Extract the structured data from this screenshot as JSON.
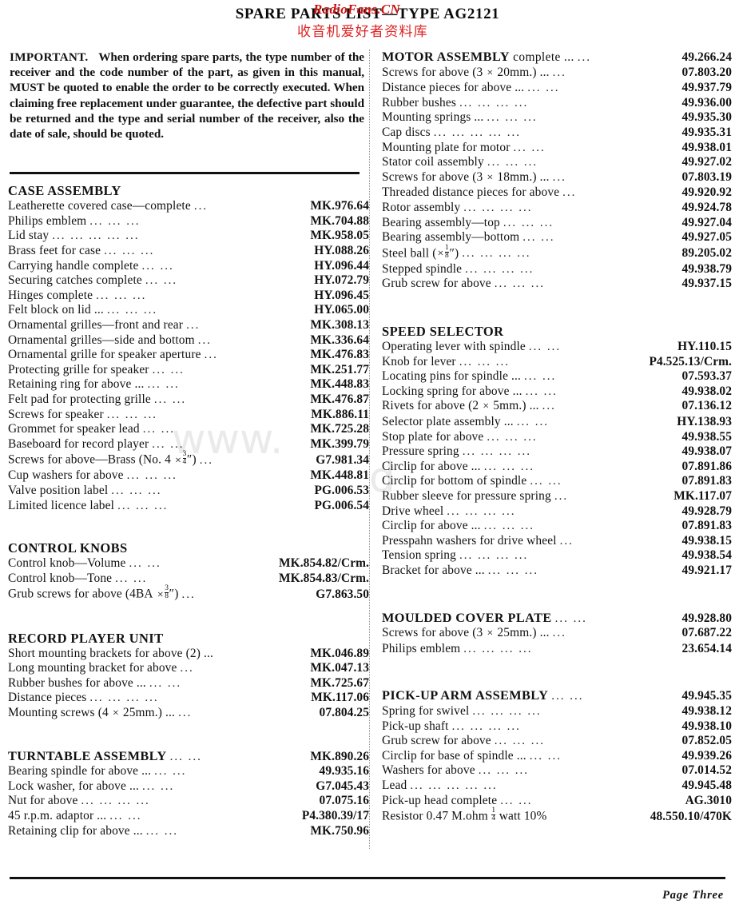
{
  "page": {
    "title": "SPARE PARTS LIST—TYPE AG2121",
    "footer": "Page Three",
    "watermark_latin": "RadioFans.CN",
    "watermark_cjk": "收音机爱好者资料库",
    "watermark_ghost_left": "www.",
    "watermark_ghost_right": "d",
    "accent_color": "#cc1111",
    "text_color": "#111111"
  },
  "intro": {
    "lead": "IMPORTANT.",
    "body": "When ordering spare parts, the type number of the receiver and the code number of the part, as given in this manual, MUST be quoted to enable the order to be correctly executed. When claiming free replacement under guarantee, the defective part should be returned and the type and serial number of the receiver, also the date of sale, should be quoted."
  },
  "left_column": {
    "sections": [
      {
        "heading": "CASE ASSEMBLY",
        "heading_style": "plain",
        "rows": [
          {
            "label": "Leatherette covered case—complete",
            "dots": "...",
            "code": "MK.976.64"
          },
          {
            "label": "Philips emblem",
            "dots": "...   ...   ...",
            "code": "MK.704.88"
          },
          {
            "label": "Lid stay",
            "dots": "...   ...   ...   ...   ...",
            "code": "MK.958.05"
          },
          {
            "label": "Brass feet for case",
            "dots": "...   ...   ...",
            "code": "HY.088.26"
          },
          {
            "label": "Carrying handle complete",
            "dots": "...   ...",
            "code": "HY.096.44"
          },
          {
            "label": "Securing catches complete",
            "dots": "...   ...",
            "code": "HY.072.79"
          },
          {
            "label": "Hinges complete",
            "dots": "...   ...   ...",
            "code": "HY.096.45"
          },
          {
            "label": "Felt block on lid ...",
            "dots": "...   ...   ...",
            "code": "HY.065.00"
          },
          {
            "label": "Ornamental grilles—front and rear",
            "dots": "...",
            "code": "MK.308.13"
          },
          {
            "label": "Ornamental grilles—side and bottom",
            "dots": "...",
            "code": "MK.336.64"
          },
          {
            "label": "Ornamental grille for speaker aperture",
            "dots": "...",
            "code": "MK.476.83"
          },
          {
            "label": "Protecting grille for speaker",
            "dots": "...   ...",
            "code": "MK.251.77"
          },
          {
            "label": "Retaining ring for above ...",
            "dots": "...   ...",
            "code": "MK.448.83"
          },
          {
            "label": "Felt pad for protecting grille",
            "dots": "...   ...",
            "code": "MK.476.87"
          },
          {
            "label": "Screws for speaker",
            "dots": "...   ...   ...",
            "code": "MK.886.11"
          },
          {
            "label": "Grommet for speaker lead",
            "dots": "...   ...",
            "code": "MK.725.28"
          },
          {
            "label": "Baseboard for record player",
            "dots": "...   ...",
            "code": "MK.399.79"
          },
          {
            "label": "Screws for above—Brass (No. 4 × 3/4\")",
            "label_frac": {
              "prefix": "Screws for above—Brass (No. 4 ",
              "num": "3",
              "den": "4",
              "suffix": "″)"
            },
            "dots": "...",
            "code": "G7.981.34"
          },
          {
            "label": "Cup washers for above",
            "dots": "...   ...   ...",
            "code": "MK.448.81"
          },
          {
            "label": "Valve position label",
            "dots": "...   ...   ...",
            "code": "PG.006.53"
          },
          {
            "label": "Limited licence label",
            "dots": "...   ...   ...",
            "code": "PG.006.54"
          }
        ]
      },
      {
        "heading": "CONTROL KNOBS",
        "heading_style": "plain",
        "rows": [
          {
            "label": "Control knob—Volume",
            "dots": "...   ...",
            "code": "MK.854.82/Crm."
          },
          {
            "label": "Control knob—Tone",
            "dots": "...   ...",
            "code": "MK.854.83/Crm."
          },
          {
            "label": "Grub screws for above (4BA × 3/8\")",
            "label_frac": {
              "prefix": "Grub screws for above (4BA ",
              "num": "3",
              "den": "8",
              "suffix": "″)"
            },
            "dots": "...",
            "code": "G7.863.50"
          }
        ]
      },
      {
        "heading": "RECORD PLAYER UNIT",
        "heading_style": "plain",
        "rows": [
          {
            "label": "Short mounting brackets for above (2) ...",
            "dots": "",
            "code": "MK.046.89"
          },
          {
            "label": "Long mounting bracket for above",
            "dots": "...",
            "code": "MK.047.13"
          },
          {
            "label": "Rubber bushes for above ...",
            "dots": "...   ...",
            "code": "MK.725.67"
          },
          {
            "label": "Distance pieces",
            "dots": "...   ...   ...   ...",
            "code": "MK.117.06"
          },
          {
            "label": "Mounting screws (4 × 25mm.) ...",
            "dots": "...",
            "code": "07.804.25"
          }
        ]
      },
      {
        "heading": "TURNTABLE ASSEMBLY",
        "heading_style": "inline",
        "heading_dots": "...   ...",
        "heading_code": "MK.890.26",
        "rows": [
          {
            "label": "Bearing spindle for above ...",
            "dots": "...   ...",
            "code": "49.935.16"
          },
          {
            "label": "Lock washer, for above ...",
            "dots": "...   ...",
            "code": "G7.045.43"
          },
          {
            "label": "Nut for above",
            "dots": "...   ...   ...   ...",
            "code": "07.075.16"
          },
          {
            "label": "45 r.p.m. adaptor ...",
            "dots": "...   ...",
            "code": "P4.380.39/17"
          },
          {
            "label": "Retaining clip for above ...",
            "dots": "...   ...",
            "code": "MK.750.96"
          }
        ]
      }
    ]
  },
  "right_column": {
    "sections": [
      {
        "heading": "MOTOR ASSEMBLY",
        "heading_style": "inline-mixed",
        "heading_tail": " complete ...",
        "heading_dots": "...",
        "heading_code": "49.266.24",
        "rows": [
          {
            "label": "Screws for above (3 × 20mm.) ...",
            "dots": "...",
            "code": "07.803.20"
          },
          {
            "label": "Distance pieces for above ...",
            "dots": "...   ...",
            "code": "49.937.79"
          },
          {
            "label": "Rubber bushes",
            "dots": "...   ...   ...   ...",
            "code": "49.936.00"
          },
          {
            "label": "Mounting springs ...",
            "dots": "...   ...   ...",
            "code": "49.935.30"
          },
          {
            "label": "Cap discs",
            "dots": "...   ...   ...   ...   ...",
            "code": "49.935.31"
          },
          {
            "label": "Mounting plate for motor",
            "dots": "...   ...",
            "code": "49.938.01"
          },
          {
            "label": "Stator coil assembly",
            "dots": "...   ...   ...",
            "code": "49.927.02"
          },
          {
            "label": "Screws for above (3 × 18mm.) ...",
            "dots": "...",
            "code": "07.803.19"
          },
          {
            "label": "Threaded distance pieces for above",
            "dots": "...",
            "code": "49.920.92"
          },
          {
            "label": "Rotor assembly",
            "dots": "...   ...   ...   ...",
            "code": "49.924.78"
          },
          {
            "label": "Bearing assembly—top",
            "dots": "...   ...   ...",
            "code": "49.927.04"
          },
          {
            "label": "Bearing assembly—bottom",
            "dots": "...   ...",
            "code": "49.927.05"
          },
          {
            "label": "Steel ball (1/8\")",
            "label_frac": {
              "prefix": "Steel ball (",
              "num": "1",
              "den": "8",
              "suffix": "″)"
            },
            "dots": "...   ...   ...   ...",
            "code": "89.205.02"
          },
          {
            "label": "Stepped spindle",
            "dots": "...   ...   ...   ...",
            "code": "49.938.79"
          },
          {
            "label": "Grub screw for above",
            "dots": "...   ...   ...",
            "code": "49.937.15"
          }
        ]
      },
      {
        "heading": "SPEED SELECTOR",
        "heading_style": "plain",
        "rows": [
          {
            "label": "Operating lever with spindle",
            "dots": "...   ...",
            "code": "HY.110.15"
          },
          {
            "label": "Knob for lever",
            "dots": "...   ...   ...",
            "code": "P4.525.13/Crm."
          },
          {
            "label": "Locating pins for spindle ...",
            "dots": "...   ...",
            "code": "07.593.37"
          },
          {
            "label": "Locking spring for above ...",
            "dots": "...   ...",
            "code": "49.938.02"
          },
          {
            "label": "Rivets for above (2 × 5mm.) ...",
            "dots": "...",
            "code": "07.136.12"
          },
          {
            "label": "Selector plate assembly ...",
            "dots": "...   ...",
            "code": "HY.138.93"
          },
          {
            "label": "Stop plate for above",
            "dots": "...   ...   ...",
            "code": "49.938.55"
          },
          {
            "label": "Pressure spring",
            "dots": "...   ...   ...   ...",
            "code": "49.938.07"
          },
          {
            "label": "Circlip for above ...",
            "dots": "...   ...   ...",
            "code": "07.891.86"
          },
          {
            "label": "Circlip for bottom of spindle",
            "dots": "...   ...",
            "code": "07.891.83"
          },
          {
            "label": "Rubber sleeve for pressure spring",
            "dots": "...",
            "code": "MK.117.07"
          },
          {
            "label": "Drive wheel",
            "dots": "...   ...   ...   ...",
            "code": "49.928.79"
          },
          {
            "label": "Circlip for above ...",
            "dots": "...   ...   ...",
            "code": "07.891.83"
          },
          {
            "label": "Presspahn washers for drive wheel",
            "dots": "...",
            "code": "49.938.15"
          },
          {
            "label": "Tension spring",
            "dots": "...   ...   ...   ...",
            "code": "49.938.54"
          },
          {
            "label": "Bracket for above ...",
            "dots": "...   ...   ...",
            "code": "49.921.17"
          }
        ]
      },
      {
        "heading": "MOULDED COVER PLATE",
        "heading_style": "inline",
        "heading_dots": "...   ...",
        "heading_code": "49.928.80",
        "rows": [
          {
            "label": "Screws for above (3 × 25mm.) ...",
            "dots": "...",
            "code": "07.687.22"
          },
          {
            "label": "Philips emblem",
            "dots": "...   ...   ...   ...",
            "code": "23.654.14"
          }
        ]
      },
      {
        "heading": "PICK-UP ARM ASSEMBLY",
        "heading_style": "inline",
        "heading_dots": "...   ...",
        "heading_code": "49.945.35",
        "rows": [
          {
            "label": "Spring for swivel",
            "dots": "...   ...   ...   ...",
            "code": "49.938.12"
          },
          {
            "label": "Pick-up shaft",
            "dots": "...   ...   ...   ...",
            "code": "49.938.10"
          },
          {
            "label": "Grub screw for above",
            "dots": "...   ...   ...",
            "code": "07.852.05"
          },
          {
            "label": "Circlip for base of spindle ...",
            "dots": "...   ...",
            "code": "49.939.26"
          },
          {
            "label": "Washers for above",
            "dots": "...   ...   ...",
            "code": "07.014.52"
          },
          {
            "label": "Lead",
            "dots": "...   ...   ...   ...   ...",
            "code": "49.945.48"
          },
          {
            "label": "Pick-up head complete",
            "dots": "...   ...",
            "code": "AG.3010"
          },
          {
            "label": "Resistor 0.47 M.ohm 1/4 watt 10%",
            "label_frac": {
              "prefix": "Resistor 0.47 M.ohm ",
              "num": "1",
              "den": "4",
              "suffix": " watt 10%"
            },
            "dots": "",
            "code": "48.550.10/470K"
          }
        ]
      }
    ]
  }
}
